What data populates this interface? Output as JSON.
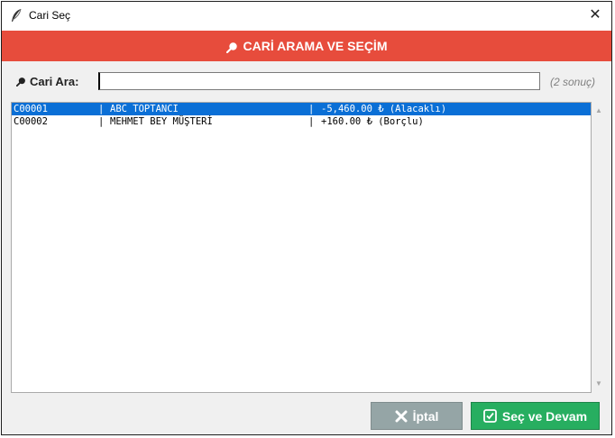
{
  "window": {
    "title": "Cari Seç",
    "close_glyph": "✕",
    "icon": "feather-icon"
  },
  "header": {
    "title": "CARİ ARAMA VE SEÇİM",
    "icon": "search-icon",
    "color": "#e74c3c"
  },
  "search": {
    "label": "Cari Ara:",
    "value": "",
    "placeholder": "",
    "result_count": "(2 sonuç)"
  },
  "list": {
    "rows": [
      {
        "code": "C00001",
        "name": "ABC TOPTANCI",
        "balance": "-5,460.00 ₺ (Alacaklı)",
        "selected": true
      },
      {
        "code": "C00002",
        "name": "MEHMET BEY MÜŞTERİ",
        "balance": "+160.00 ₺ (Borçlu)",
        "selected": false
      }
    ],
    "separator": "|",
    "selection_color": "#0a6fd6"
  },
  "buttons": {
    "cancel": {
      "label": "İptal",
      "icon": "x-icon",
      "color": "#95a5a6"
    },
    "ok": {
      "label": "Seç ve Devam",
      "icon": "checkbox-icon",
      "color": "#27ae60"
    }
  }
}
